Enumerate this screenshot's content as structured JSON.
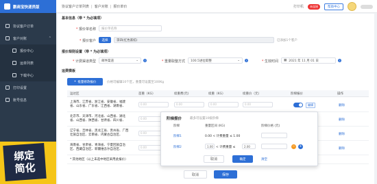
{
  "sidebar": {
    "brand": "鹏商宝快递员版",
    "items": [
      {
        "label": "协议客户订单"
      },
      {
        "label": "客户对账"
      },
      {
        "label": "报价中心"
      },
      {
        "label": "运单列表"
      },
      {
        "label": "下载中心"
      },
      {
        "label": "打印设置"
      },
      {
        "label": "账号信息"
      }
    ],
    "promo_line1": "绑定",
    "promo_line2": "简化"
  },
  "header": {
    "breadcrumb": [
      "协议客户订单列表",
      "客户对账",
      "报价单价"
    ],
    "print": "打印机",
    "badge": "未连接",
    "help": "帮助中心"
  },
  "basic": {
    "title": "基本信息（带 * 为必填项）",
    "name_label": "报价单名称",
    "name_placeholder": "报价单名称",
    "customer_label": "报价客户",
    "select_btn": "选择",
    "customer_value": "李四(红色家纺)",
    "customer_hint": "已添加1个客户"
  },
  "rule": {
    "title": "报价规则设置（带 * 为必填项）",
    "carrier_label": "计费渠道类型",
    "carrier_value": "邮件渠道",
    "weight_label": "重量取整方式",
    "weight_value": "100.5进位取整",
    "effective_label": "生效时间",
    "effective_value": "2021 年 11 月 01 日"
  },
  "freight": {
    "title": "运费模板",
    "add_btn": "批量修改报价",
    "hint": "价格可编辑10个区，重量可设置至100Kg",
    "headers": [
      "运达区",
      "首重（KG）",
      "续重费(元)",
      "续重（KG）",
      "续重价（元）",
      "阶梯报价",
      "操作"
    ],
    "rows": [
      {
        "region": "上海市、江苏省、浙江省、安徽省、福建省、山东省、广东省、江西省、湖南省、",
        "tag": "编辑",
        "op": "删除"
      },
      {
        "region": "北京市、天津市、河北省、山西省、湖北省、山西省、陕西省、甘肃省、四川省、",
        "op": "删除"
      },
      {
        "region": "辽宁省、吉林省、黑龙江省、贵州省、广西壮族自治区、云南省、内蒙古自治区、",
        "op": "删除"
      },
      {
        "region": "海南省、甘肃省、青海省、宁夏回族自治区、西藏自治区、新疆维吾尔自治区、",
        "op": "删除"
      },
      {
        "region": "* 其他地区（以上未选中地区采用此报价）",
        "op": ""
      }
    ],
    "placeholder": "0.00"
  },
  "popover": {
    "title": "阶梯报价",
    "subtitle": "最多可设置10级阶梯",
    "headers": [
      "阶梯",
      "重量区间 (KG)",
      "阶梯价格 (元)"
    ],
    "rows": [
      {
        "level": "阶梯1",
        "range": "0.00 < 计费重量 ≤ 1.00",
        "price": ""
      },
      {
        "level": "阶梯2",
        "range_start": "1.00",
        "range_mid": "< 计费重量 ≤",
        "range_end": "2.00",
        "price": ""
      }
    ],
    "cancel": "取消",
    "confirm": "确定",
    "clear": "清空"
  },
  "footer": {
    "cancel": "取消",
    "save": "保存"
  }
}
